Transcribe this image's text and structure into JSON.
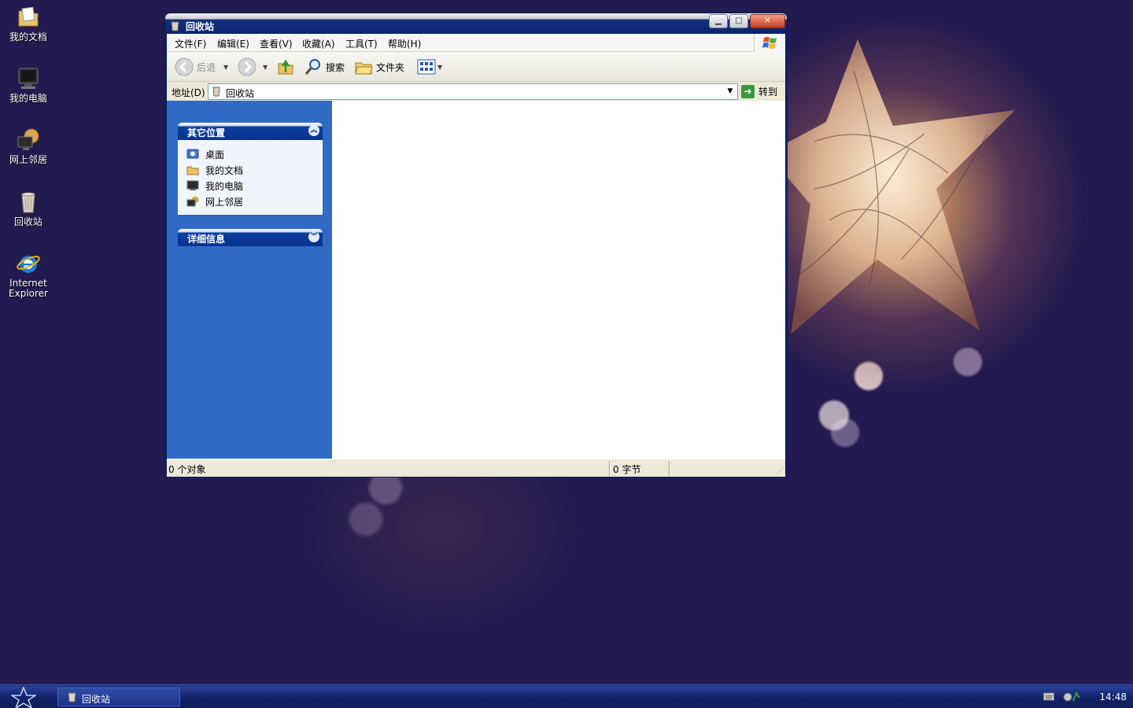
{
  "desktop": {
    "icons": [
      {
        "label": "我的文档",
        "icon": "my-documents-icon"
      },
      {
        "label": "我的电脑",
        "icon": "my-computer-icon"
      },
      {
        "label": "网上邻居",
        "icon": "network-places-icon"
      },
      {
        "label": "回收站",
        "icon": "recycle-bin-icon"
      },
      {
        "label": "Internet Explorer",
        "icon": "internet-explorer-icon"
      }
    ]
  },
  "window": {
    "title": "回收站",
    "menu": [
      "文件(F)",
      "编辑(E)",
      "查看(V)",
      "收藏(A)",
      "工具(T)",
      "帮助(H)"
    ],
    "toolbar": {
      "back": "后退",
      "search": "搜索",
      "folders": "文件夹"
    },
    "address": {
      "label": "地址(D)",
      "value": "回收站",
      "go": "转到"
    },
    "taskpane": {
      "other_places": {
        "title": "其它位置",
        "items": [
          "桌面",
          "我的文档",
          "我的电脑",
          "网上邻居"
        ]
      },
      "details": {
        "title": "详细信息"
      }
    },
    "status": {
      "objects": "0 个对象",
      "size": "0 字节"
    }
  },
  "taskbar": {
    "active_task": "回收站",
    "clock": "14:48"
  },
  "colors": {
    "desktop_bg": "#231a4f",
    "taskpane_bg": "#316ac5",
    "title_bar": "#0a246a"
  }
}
